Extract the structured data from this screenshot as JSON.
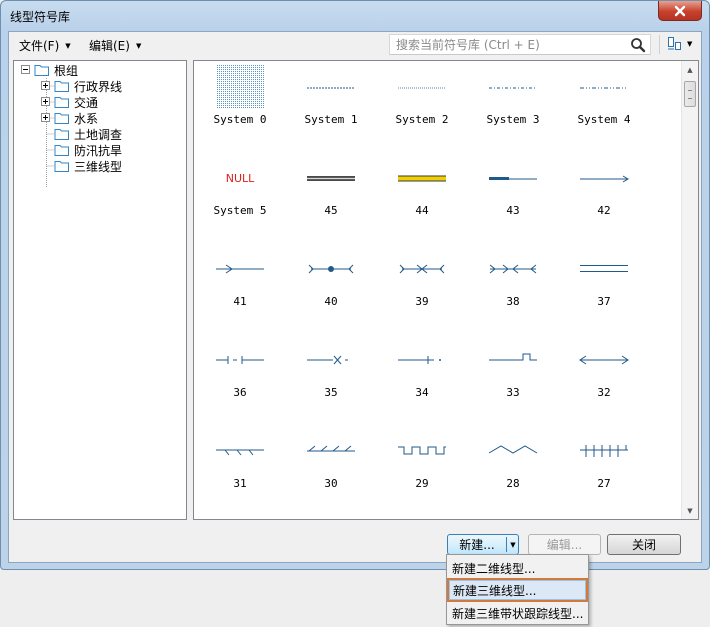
{
  "window": {
    "title": "线型符号库"
  },
  "menu": {
    "file": "文件(F)",
    "edit": "编辑(E)",
    "search_placeholder": "搜索当前符号库 (Ctrl + E)"
  },
  "tree": {
    "root": "根组",
    "children": [
      "行政界线",
      "交通",
      "水系",
      "土地调查",
      "防汛抗旱",
      "三维线型"
    ]
  },
  "symbols": [
    "System 0",
    "System 1",
    "System 2",
    "System 3",
    "System 4",
    "System 5",
    "45",
    "44",
    "43",
    "42",
    "41",
    "40",
    "39",
    "38",
    "37",
    "36",
    "35",
    "34",
    "33",
    "32",
    "31",
    "30",
    "29",
    "28",
    "27"
  ],
  "null_label": "NULL",
  "buttons": {
    "new": "新建...",
    "edit": "编辑...",
    "close": "关闭"
  },
  "dropdown": [
    "新建二维线型...",
    "新建三维线型...",
    "新建三维带状跟踪线型..."
  ],
  "colors": {
    "line": "#1f5a8a",
    "null": "#e0201e",
    "highlight": "#d17a3c"
  }
}
